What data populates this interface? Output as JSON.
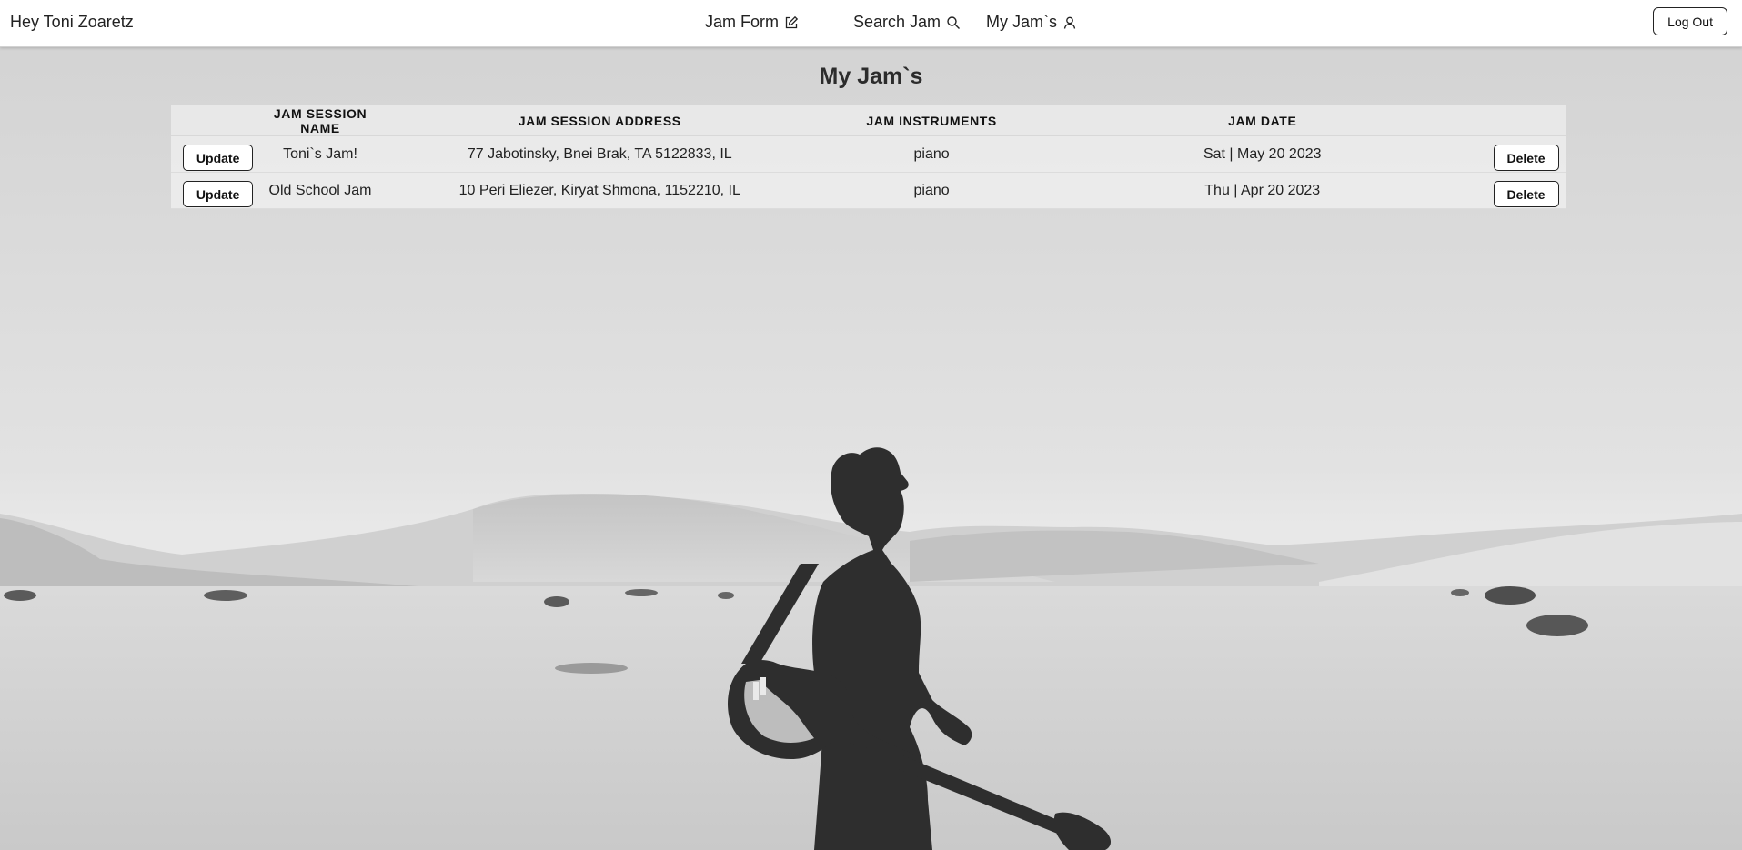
{
  "navbar": {
    "greeting": "Hey Toni Zoaretz",
    "links": [
      {
        "label": "Jam Form",
        "icon": "edit-icon"
      },
      {
        "label": "Search Jam",
        "icon": "search-icon"
      },
      {
        "label": "My Jam`s",
        "icon": "user-icon"
      }
    ],
    "logout_label": "Log Out"
  },
  "page": {
    "title": "My Jam`s"
  },
  "table": {
    "headers": [
      "JAM SESSION NAME",
      "JAM SESSION ADDRESS",
      "JAM INSTRUMENTS",
      "JAM DATE"
    ],
    "update_label": "Update",
    "delete_label": "Delete",
    "rows": [
      {
        "name": "Toni`s Jam!",
        "address": "77 Jabotinsky, Bnei Brak, TA 5122833, IL",
        "instruments": "piano",
        "date": "Sat | May 20 2023"
      },
      {
        "name": "Old School Jam",
        "address": "10 Peri Eliezer, Kiryat Shmona, 1152210, IL",
        "instruments": "piano",
        "date": "Thu | Apr 20 2023"
      }
    ]
  },
  "background": {
    "description_icon": "desert-guitarist-photo",
    "colors": {
      "sky": "#dedede",
      "sand": "#d3d3d3",
      "silhouette": "#2e2e2e"
    }
  }
}
